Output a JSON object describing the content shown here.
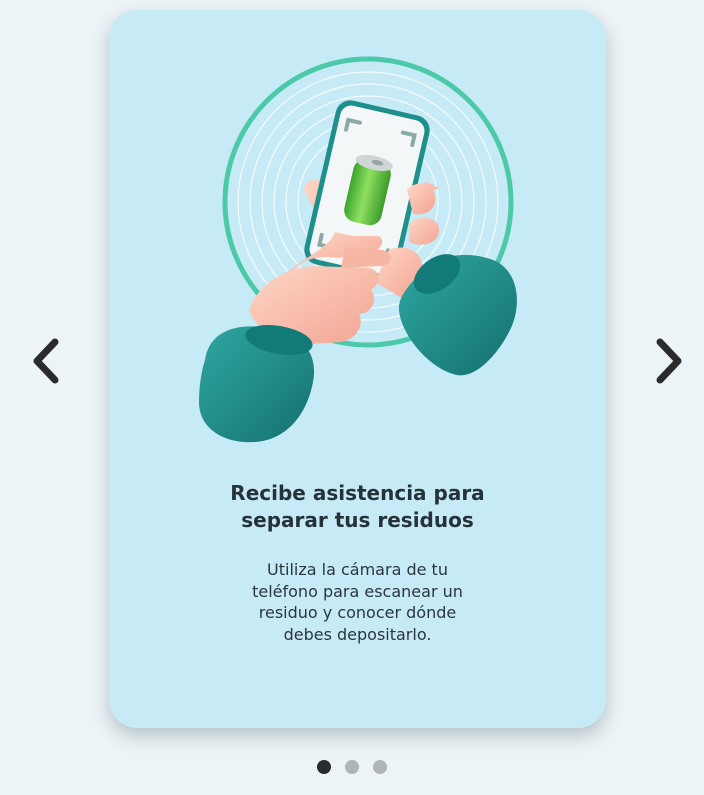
{
  "slide": {
    "title_lines": [
      "Recibe asistencia para",
      "separar tus residuos"
    ],
    "body_lines": [
      "Utiliza la cámara de tu",
      "teléfono para escanear un",
      "residuo y conocer dónde",
      "debes depositarlo."
    ],
    "illustration_icon": "hands-scanning-phone-icon"
  },
  "navigation": {
    "prev_icon": "chevron-left-icon",
    "next_icon": "chevron-right-icon"
  },
  "pagination": {
    "total": 3,
    "current": 1
  },
  "colors": {
    "background": "#edf4f7",
    "card": "#c6eaf6",
    "accent_teal": "#1f8f8c",
    "ring": "#4cc9a8",
    "text": "#26323a",
    "dot_active": "#2b2b2b",
    "dot_inactive": "#aeb4b7"
  }
}
